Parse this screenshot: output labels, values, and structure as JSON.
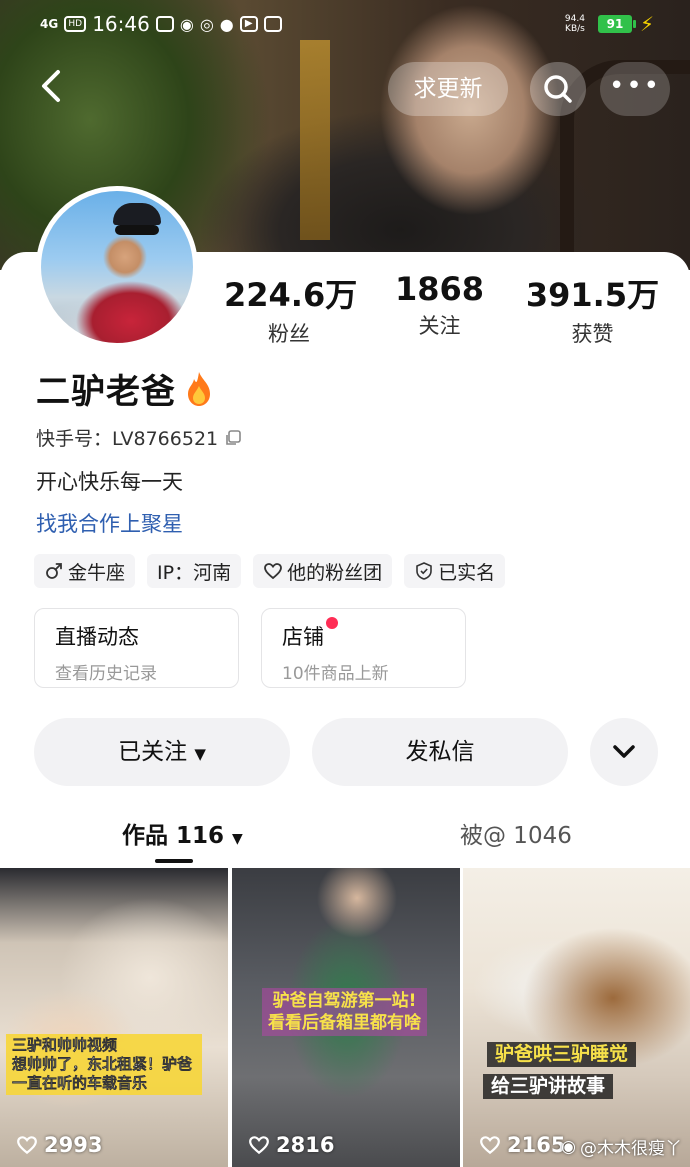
{
  "status_bar": {
    "network": "4G",
    "hd": "HD",
    "time": "16:46",
    "speed": "94.4 KB/s",
    "battery": "91"
  },
  "nav": {
    "request_update": "求更新"
  },
  "profile": {
    "stats": [
      {
        "value": "224.6万",
        "label": "粉丝"
      },
      {
        "value": "1868",
        "label": "关注"
      },
      {
        "value": "391.5万",
        "label": "获赞"
      }
    ],
    "name": "二驴老爸",
    "kuaishou_id": "快手号：LV8766521",
    "bio": "开心快乐每一天",
    "coop_link": "找我合作上聚星",
    "tags": [
      {
        "icon": "male-icon",
        "label": "金牛座"
      },
      {
        "icon": "",
        "label": "IP：河南"
      },
      {
        "icon": "heart-icon",
        "label": "他的粉丝团"
      },
      {
        "icon": "verified-shield-icon",
        "label": "已实名"
      }
    ],
    "features": [
      {
        "title": "直播动态",
        "sub": "查看历史记录"
      },
      {
        "title": "店铺",
        "sub": "10件商品上新"
      }
    ]
  },
  "actions": {
    "followed": "已关注",
    "message": "发私信"
  },
  "tabs": {
    "works": "作品 116",
    "mentioned": "被@ 1046"
  },
  "videos": [
    {
      "caption_lines": [
        "三驴和帅帅视频",
        "想帅帅了，东北租紧！驴爸",
        "一直在听的车载音乐"
      ],
      "likes": "2993"
    },
    {
      "caption_lines": [
        "驴爸自驾游第一站!",
        "看看后备箱里都有啥"
      ],
      "likes": "2816"
    },
    {
      "caption_lines": [
        "驴爸哄三驴睡觉",
        "给三驴讲故事"
      ],
      "likes": "2165"
    }
  ],
  "watermark": "@木木很瘦丫",
  "colors": {
    "link": "#2f5fb0",
    "red_dot": "#ff2d55",
    "battery": "#31c14a"
  }
}
